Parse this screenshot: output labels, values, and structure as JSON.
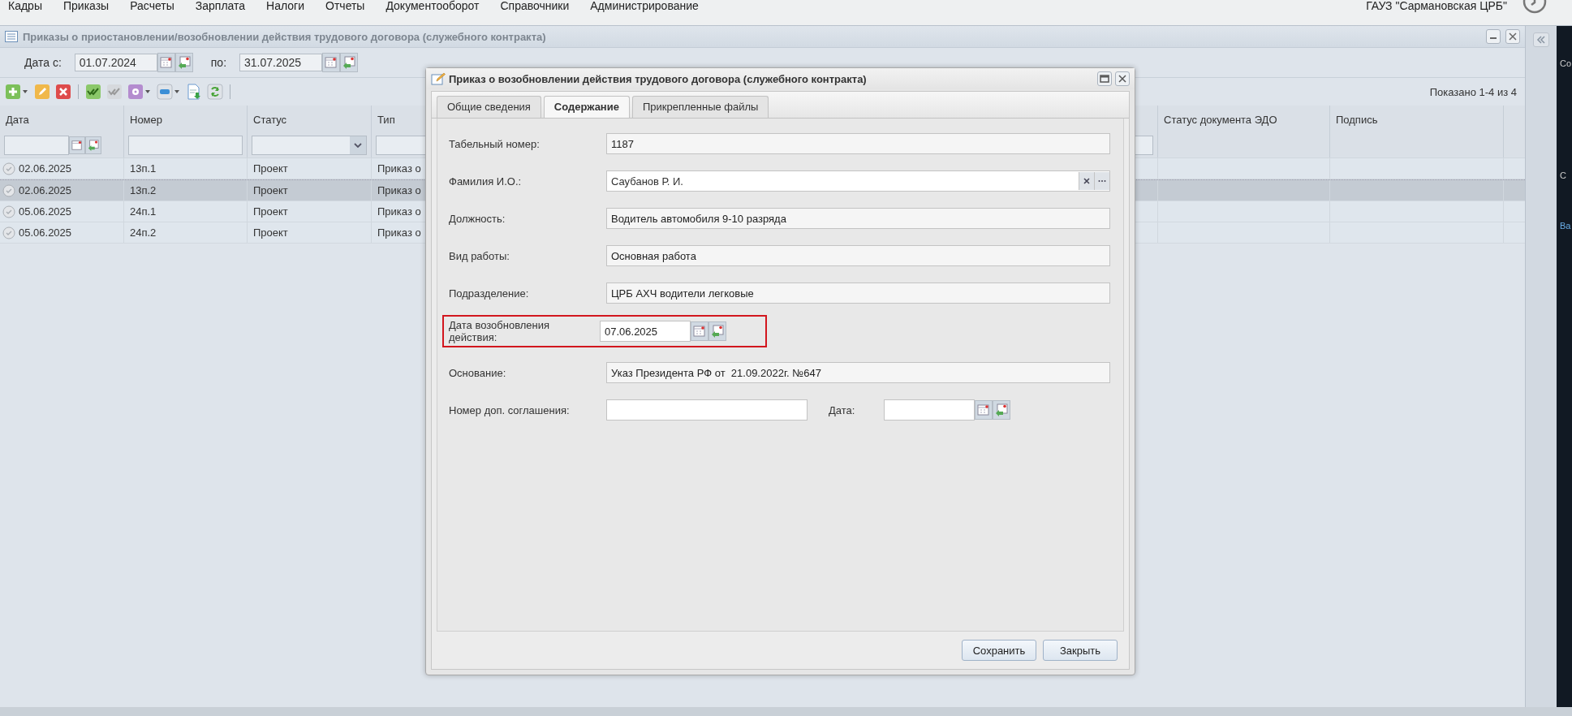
{
  "menu": {
    "items": [
      "Кадры",
      "Приказы",
      "Расчеты",
      "Зарплата",
      "Налоги",
      "Отчеты",
      "Документооборот",
      "Справочники",
      "Администрирование"
    ],
    "organization": "ГАУЗ \"Сармановская ЦРБ\""
  },
  "panel": {
    "title": "Приказы о приостановлении/возобновлении действия трудового договора (служебного контракта)",
    "filter": {
      "from_label": "Дата с:",
      "from_value": "01.07.2024",
      "to_label": "по:",
      "to_value": "31.07.2025"
    },
    "toolbar": [
      {
        "kind": "add",
        "disabled": false
      },
      {
        "kind": "edit",
        "disabled": false
      },
      {
        "kind": "delete",
        "disabled": false
      },
      {
        "kind": "separator"
      },
      {
        "kind": "approve",
        "disabled": false
      },
      {
        "kind": "approve",
        "disabled": true
      },
      {
        "kind": "settings",
        "disabled": false
      },
      {
        "kind": "print",
        "disabled": false
      },
      {
        "kind": "export",
        "disabled": false
      },
      {
        "kind": "refresh",
        "disabled": false
      },
      {
        "kind": "separator"
      }
    ],
    "paging": "Показано 1-4 из 4",
    "columns": [
      {
        "label": "Дата",
        "kind": "date"
      },
      {
        "label": "Номер",
        "kind": "text"
      },
      {
        "label": "Статус",
        "kind": "combo"
      },
      {
        "label": "Тип",
        "kind": "text"
      },
      {
        "label": "Статус документа ЭДО",
        "kind": "none"
      },
      {
        "label": "Подпись",
        "kind": "none"
      }
    ],
    "rows": [
      {
        "date": "02.06.2025",
        "number": "13п.1",
        "status": "Проект",
        "type": "Приказ о",
        "selected": false
      },
      {
        "date": "02.06.2025",
        "number": "13п.2",
        "status": "Проект",
        "type": "Приказ о",
        "selected": true
      },
      {
        "date": "05.06.2025",
        "number": "24п.1",
        "status": "Проект",
        "type": "Приказ о",
        "selected": false
      },
      {
        "date": "05.06.2025",
        "number": "24п.2",
        "status": "Проект",
        "type": "Приказ о",
        "selected": false
      }
    ]
  },
  "side_strip": [
    "Со",
    "С",
    "Ва"
  ],
  "dialog": {
    "title": "Приказ о возобновлении действия трудового договора (служебного контракта)",
    "tabs": [
      {
        "label": "Общие сведения",
        "selected": false
      },
      {
        "label": "Содержание",
        "selected": true
      },
      {
        "label": "Прикрепленные файлы",
        "selected": false
      }
    ],
    "fields": [
      {
        "kind": "text",
        "label": "Табельный номер:",
        "value": "1187",
        "highlighted": false
      },
      {
        "kind": "lookup",
        "label": "Фамилия И.О.:",
        "value": "Саубанов Р. И.",
        "highlighted": false
      },
      {
        "kind": "text",
        "label": "Должность:",
        "value": "Водитель автомобиля 9-10 разряда",
        "highlighted": false
      },
      {
        "kind": "text",
        "label": "Вид работы:",
        "value": "Основная работа",
        "highlighted": false
      },
      {
        "kind": "text",
        "label": "Подразделение:",
        "value": "ЦРБ АХЧ водители легковые",
        "highlighted": false
      },
      {
        "kind": "date",
        "label": "Дата возобновления действия:",
        "value": "07.06.2025",
        "highlighted": true
      },
      {
        "kind": "text",
        "label": "Основание:",
        "value": "Указ Президента РФ от  21.09.2022г. №647",
        "highlighted": false
      },
      {
        "kind": "agreement",
        "label": "Номер доп. соглашения:",
        "date_label": "Дата:",
        "highlighted": false
      }
    ],
    "buttons": [
      "Сохранить",
      "Закрыть"
    ]
  }
}
